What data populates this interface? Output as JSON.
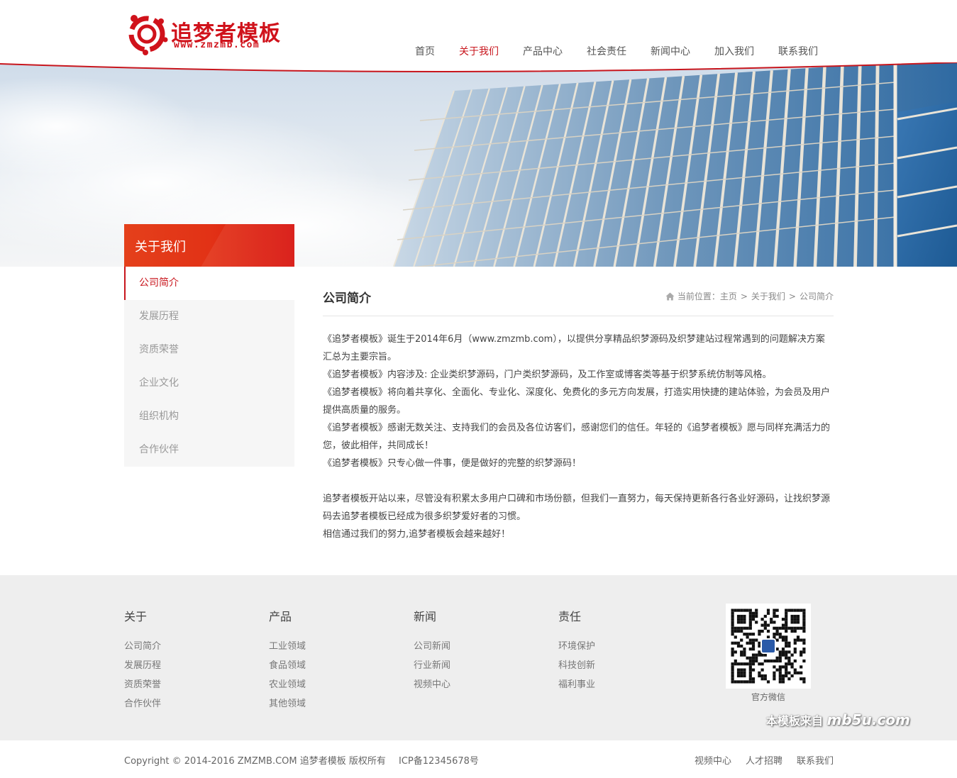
{
  "header": {
    "logo_text": "追梦者模板",
    "logo_url": "www.zmzmb.com",
    "brand_color": "#d0121b",
    "nav": [
      {
        "label": "首页",
        "active": false
      },
      {
        "label": "关于我们",
        "active": true
      },
      {
        "label": "产品中心",
        "active": false
      },
      {
        "label": "社会责任",
        "active": false
      },
      {
        "label": "新闻中心",
        "active": false
      },
      {
        "label": "加入我们",
        "active": false
      },
      {
        "label": "联系我们",
        "active": false
      }
    ]
  },
  "sidebar": {
    "title": "关于我们",
    "items": [
      {
        "label": "公司简介",
        "active": true
      },
      {
        "label": "发展历程",
        "active": false
      },
      {
        "label": "资质荣誉",
        "active": false
      },
      {
        "label": "企业文化",
        "active": false
      },
      {
        "label": "组织机构",
        "active": false
      },
      {
        "label": "合作伙伴",
        "active": false
      }
    ]
  },
  "main": {
    "title": "公司简介",
    "breadcrumb": {
      "prefix": "当前位置：",
      "items": [
        "主页",
        "关于我们",
        "公司简介"
      ],
      "separator": ">"
    },
    "paragraphs": [
      "《追梦者模板》诞生于2014年6月（www.zmzmb.com），以提供分享精品织梦源码及织梦建站过程常遇到的问题解决方案汇总为主要宗旨。",
      "《追梦者模板》内容涉及: 企业类织梦源码，门户类织梦源码，及工作室或博客类等基于织梦系统仿制等风格。",
      "《追梦者模板》将向着共享化、全面化、专业化、深度化、免费化的多元方向发展，打造实用快捷的建站体验，为会员及用户提供高质量的服务。",
      "《追梦者模板》感谢无数关注、支持我们的会员及各位访客们，感谢您们的信任。年轻的《追梦者模板》愿与同样充满活力的您，彼此相伴，共同成长！",
      "《追梦者模板》只专心做一件事，便是做好的完整的织梦源码！",
      "",
      "追梦者模板开站以来，尽管没有积累太多用户口碑和市场份额，但我们一直努力，每天保持更新各行各业好源码，让找织梦源码去追梦者模板已经成为很多织梦爱好者的习惯。",
      "相信通过我们的努力,追梦者模板会越来越好！"
    ]
  },
  "footer": {
    "columns": [
      {
        "title": "关于",
        "links": [
          "公司简介",
          "发展历程",
          "资质荣誉",
          "合作伙伴"
        ]
      },
      {
        "title": "产品",
        "links": [
          "工业领域",
          "食品领域",
          "农业领域",
          "其他领域"
        ]
      },
      {
        "title": "新闻",
        "links": [
          "公司新闻",
          "行业新闻",
          "视频中心"
        ]
      },
      {
        "title": "责任",
        "links": [
          "环境保护",
          "科技创新",
          "福利事业"
        ]
      }
    ],
    "qr_label": "官方微信",
    "watermark_prefix": "本模板来自",
    "watermark_brand": "mb5u.com",
    "copyright": "Copyright © 2014-2016 ZMZMB.COM 追梦者模板 版权所有",
    "icp": "ICP备12345678号",
    "bottom_links": [
      "视频中心",
      "人才招聘",
      "联系我们"
    ]
  }
}
